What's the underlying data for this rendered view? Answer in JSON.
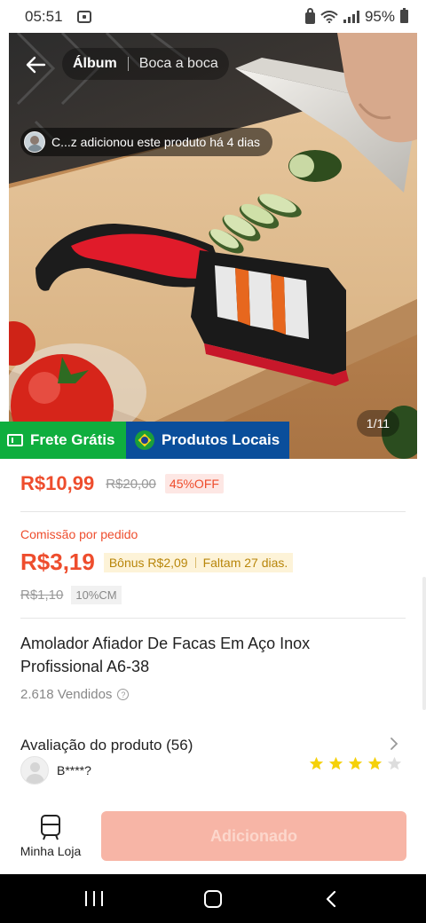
{
  "status_bar": {
    "time": "05:51",
    "battery": "95%"
  },
  "header": {
    "tab_album": "Álbum",
    "tab_boca": "Boca a boca",
    "notice": "C...z adicionou este produto há 4 dias",
    "image_counter": "1/11"
  },
  "tags": {
    "frete": "Frete Grátis",
    "locais": "Produtos Locais"
  },
  "price": {
    "current": "R$10,99",
    "old": "R$20,00",
    "discount": "45%OFF"
  },
  "commission": {
    "label": "Comissão por pedido",
    "value": "R$3,19",
    "bonus": "Bônus R$2,09",
    "remaining": "Faltam 27 dias.",
    "old": "R$1,10",
    "cm": "10%CM"
  },
  "product": {
    "title": "Amolador Afiador De Facas Em Aço Inox Profissional A6-38",
    "sold": "2.618 Vendidos"
  },
  "reviews": {
    "title": "Avaliação do produto (56)",
    "reviewer": "B****?",
    "rating": 4,
    "max_rating": 5
  },
  "bottom": {
    "store_label": "Minha Loja",
    "add_label": "Adicionado"
  },
  "colors": {
    "accent": "#ee4d2d",
    "star_filled": "#f5d10a",
    "star_empty": "#dddddd",
    "frete_green": "#0fae3e",
    "locais_blue": "#0a4e9b"
  }
}
